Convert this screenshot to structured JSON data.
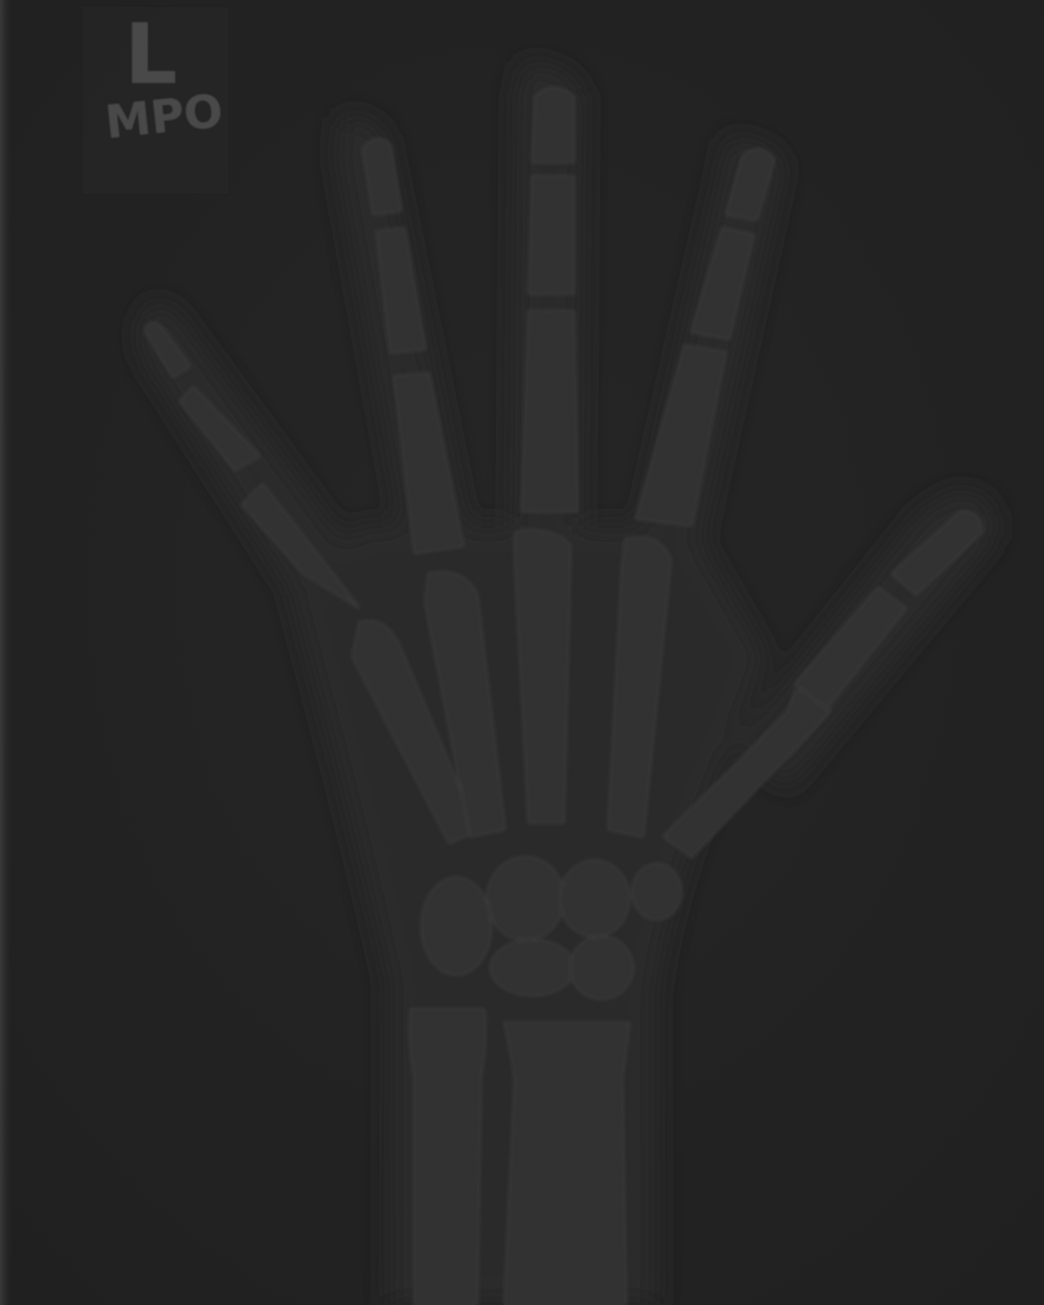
{
  "image": {
    "subject": "hand-radiograph",
    "view": "PA",
    "background_color": "#242424",
    "bone_color": "#3a3a3a",
    "soft_tissue_color": "#2e2e2e",
    "marker_color": "#4a4a4a"
  },
  "marker": {
    "side_letter": "L",
    "technologist_initials": "MPO"
  }
}
